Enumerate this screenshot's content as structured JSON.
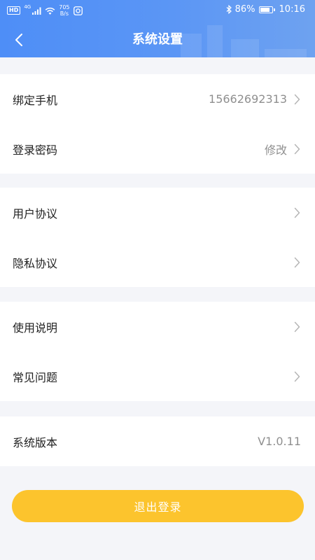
{
  "status_bar": {
    "hd": "HD",
    "network": "4G",
    "speed_value": "705",
    "speed_unit": "B/s",
    "battery_percent": "86%",
    "battery_level": 0.86,
    "time": "10:16"
  },
  "header": {
    "title": "系统设置",
    "back_icon": "chevron-left-icon"
  },
  "sections": [
    {
      "rows": [
        {
          "label": "绑定手机",
          "value": "15662692313",
          "chevron": true
        },
        {
          "label": "登录密码",
          "value": "修改",
          "chevron": true
        }
      ]
    },
    {
      "rows": [
        {
          "label": "用户协议",
          "value": "",
          "chevron": true
        },
        {
          "label": "隐私协议",
          "value": "",
          "chevron": true
        }
      ]
    },
    {
      "rows": [
        {
          "label": "使用说明",
          "value": "",
          "chevron": true
        },
        {
          "label": "常见问题",
          "value": "",
          "chevron": true
        }
      ]
    },
    {
      "rows": [
        {
          "label": "系统版本",
          "value": "V1.0.11",
          "chevron": false
        }
      ]
    }
  ],
  "logout": {
    "label": "退出登录"
  },
  "colors": {
    "header_start": "#4e8ef7",
    "header_end": "#6ea2f0",
    "page_bg": "#f4f5f9",
    "logout_bg": "#fcc42d",
    "value_text": "#8f8f8f"
  }
}
